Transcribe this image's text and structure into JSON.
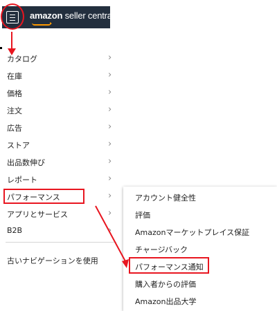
{
  "header": {
    "brand_amazon": "amazon",
    "brand_rest": " seller central",
    "menu_button_icon": "hamburger-menu-icon",
    "background_color": "#232f3e",
    "accent_color": "#ff9900"
  },
  "menu": {
    "items": [
      {
        "label": "カタログ"
      },
      {
        "label": "在庫"
      },
      {
        "label": "価格"
      },
      {
        "label": "注文"
      },
      {
        "label": "広告"
      },
      {
        "label": "ストア"
      },
      {
        "label": "出品数伸び"
      },
      {
        "label": "レポート"
      },
      {
        "label": "パフォーマンス"
      },
      {
        "label": "アプリとサービス"
      },
      {
        "label": "B2B"
      }
    ],
    "legacy_nav": "古いナビゲーションを使用"
  },
  "submenu": {
    "items": [
      {
        "label": "アカウント健全性"
      },
      {
        "label": "評価"
      },
      {
        "label": "Amazonマーケットプレイス保証"
      },
      {
        "label": "チャージバック"
      },
      {
        "label": "パフォーマンス通知"
      },
      {
        "label": "購入者からの評価"
      },
      {
        "label": "Amazon出品大学"
      }
    ]
  },
  "annotations": {
    "highlight_color": "#e8151f"
  }
}
